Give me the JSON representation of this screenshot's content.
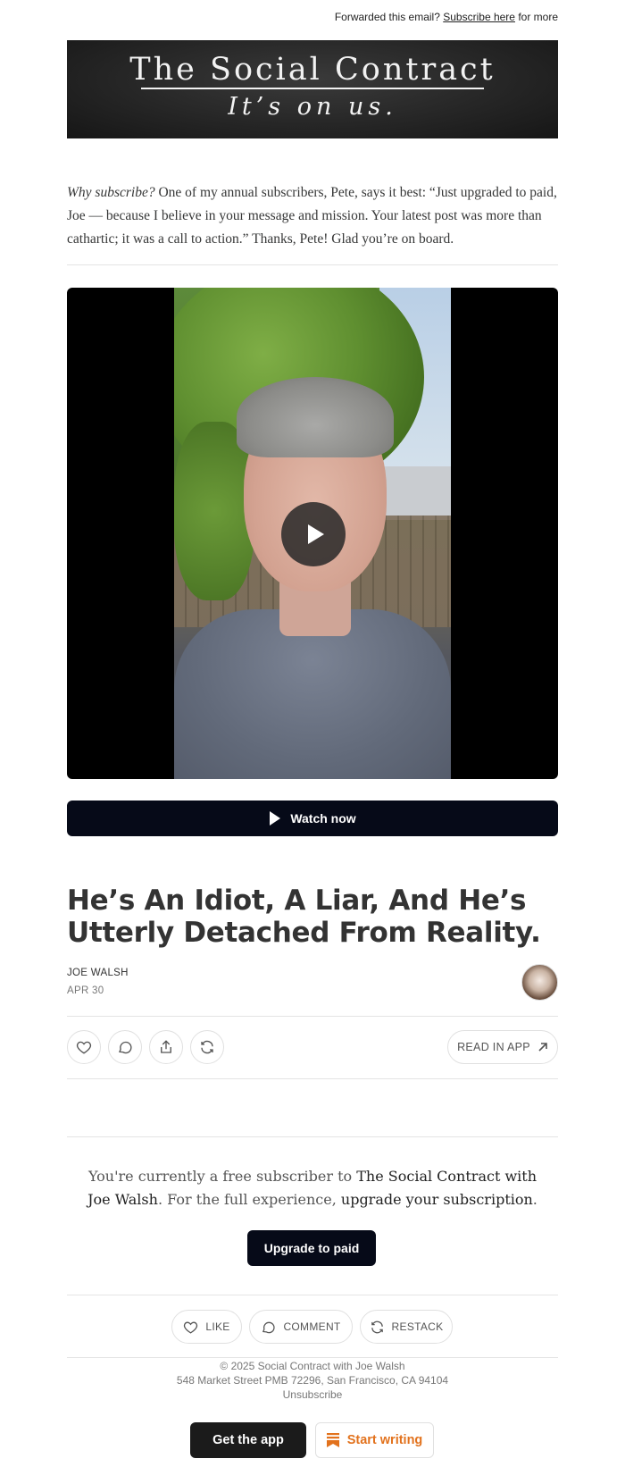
{
  "top_notice": {
    "prefix": "Forwarded this email?",
    "link": "Subscribe here",
    "suffix": "for more"
  },
  "banner": {
    "title": "The Social Contract",
    "tagline": "It’s on us."
  },
  "intro": {
    "italic_lead": "Why subscribe?",
    "text": "One of my annual subscribers, Pete, says it best: “Just upgraded to paid, Joe — because I believe in your message and mission. Your latest post was more than cathartic; it was a call to action.” Thanks, Pete! Glad you’re on board."
  },
  "video": {
    "play_icon": "play-icon",
    "watch_label": "Watch now"
  },
  "post": {
    "title": "He’s An Idiot, A Liar, And He’s Utterly Detached From Reality.",
    "author": "JOE WALSH",
    "date": "APR 30"
  },
  "actions": {
    "icons": [
      "heart-icon",
      "comment-icon",
      "share-icon",
      "restack-icon"
    ],
    "read_in_app": "READ IN APP"
  },
  "subscription": {
    "part1": "You're currently a free subscriber to ",
    "publication": "The Social Contract with Joe Walsh",
    "part2": ". For the full experience, ",
    "link": "upgrade your subscription",
    "part3": ".",
    "button": "Upgrade to paid"
  },
  "engage": {
    "like": "LIKE",
    "comment": "COMMENT",
    "restack": "RESTACK"
  },
  "footer": {
    "copyright": "© 2025 Social Contract with Joe Walsh",
    "address": "548 Market Street PMB 72296, San Francisco, CA 94104",
    "unsubscribe": "Unsubscribe"
  },
  "cta": {
    "get_app": "Get the app",
    "start_writing": "Start writing"
  },
  "colors": {
    "dark_button": "#060a18",
    "accent_orange": "#e2721d"
  }
}
